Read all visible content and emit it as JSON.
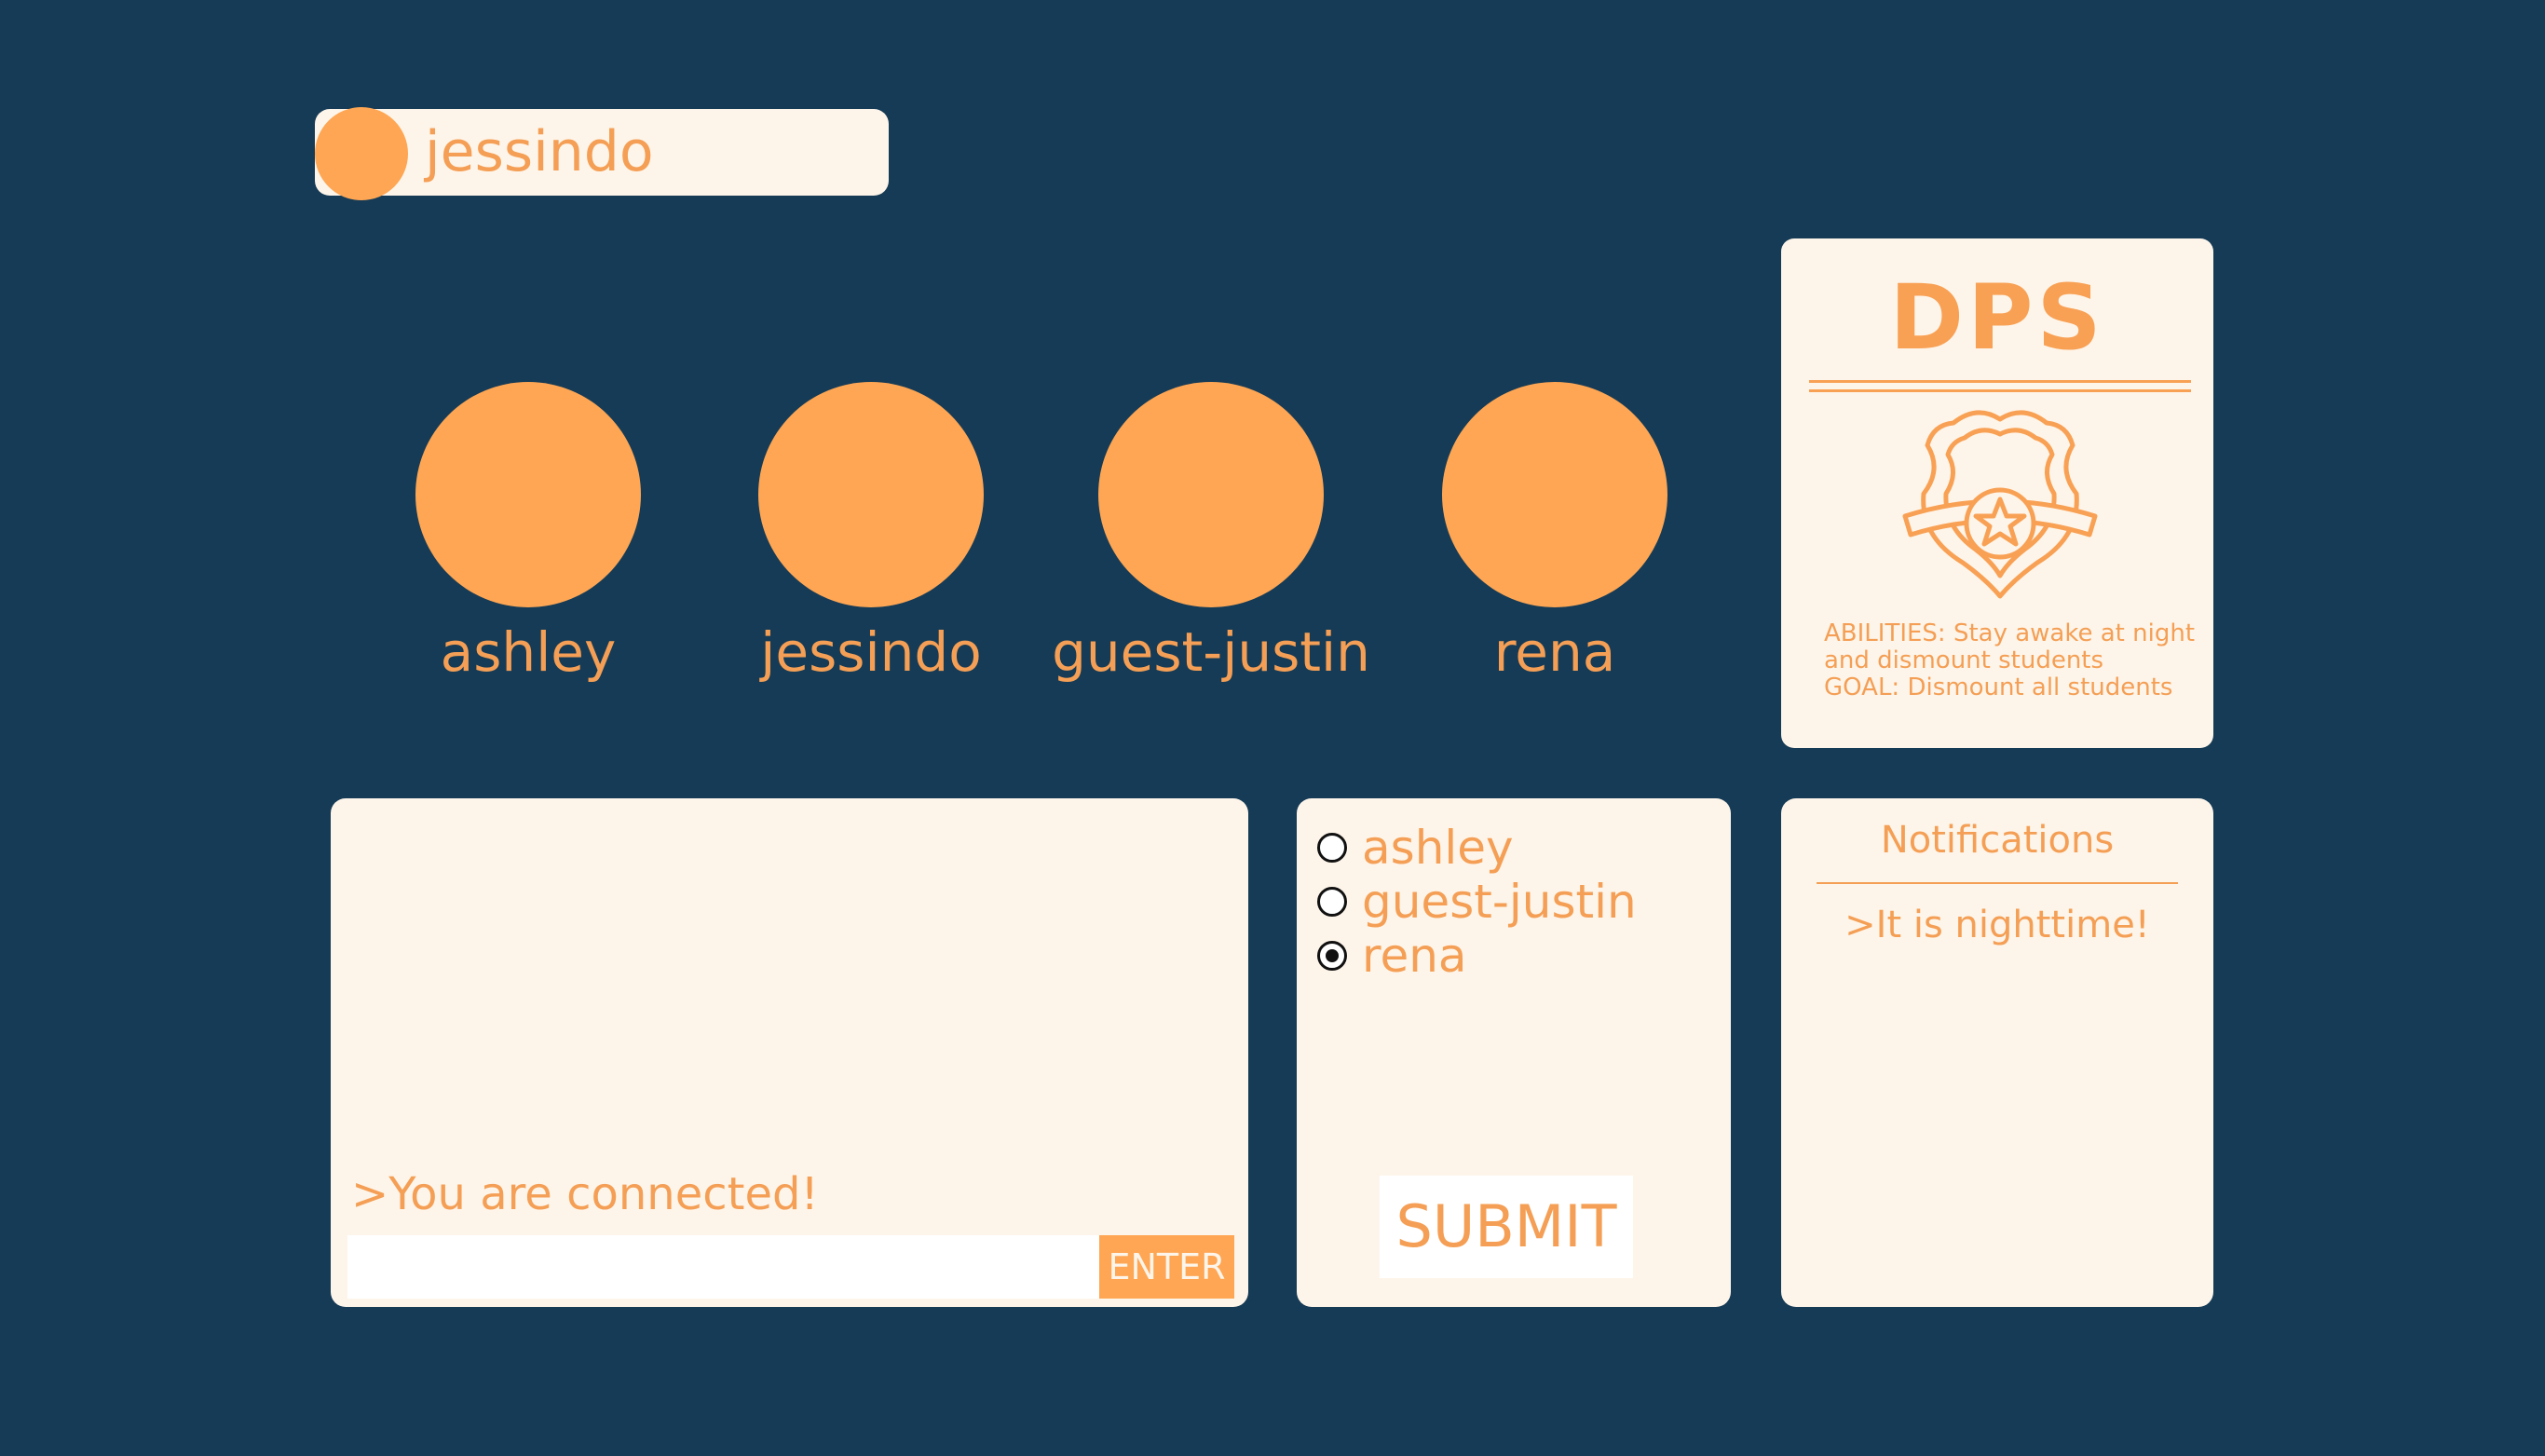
{
  "current_user": {
    "name": "jessindo"
  },
  "players": [
    {
      "name": "ashley"
    },
    {
      "name": "jessindo"
    },
    {
      "name": "guest-justin"
    },
    {
      "name": "rena"
    }
  ],
  "role_card": {
    "title": "DPS",
    "abilities_line1": "ABILITIES: Stay awake at night",
    "abilities_line2": "and dismount students",
    "goal": "GOAL: Dismount all students",
    "icon": "police-badge-icon"
  },
  "chat": {
    "messages": [
      ">You are connected!"
    ],
    "input_value": "",
    "enter_label": "ENTER"
  },
  "vote": {
    "options": [
      {
        "label": "ashley",
        "selected": false
      },
      {
        "label": "guest-justin",
        "selected": false
      },
      {
        "label": "rena",
        "selected": true
      }
    ],
    "submit_label": "SUBMIT"
  },
  "notifications": {
    "title": "Notifications",
    "items": [
      ">It is nighttime!"
    ]
  },
  "colors": {
    "background": "#163b56",
    "accent": "#fea653",
    "text_accent": "#f49f55",
    "panel": "#fef5ea"
  }
}
